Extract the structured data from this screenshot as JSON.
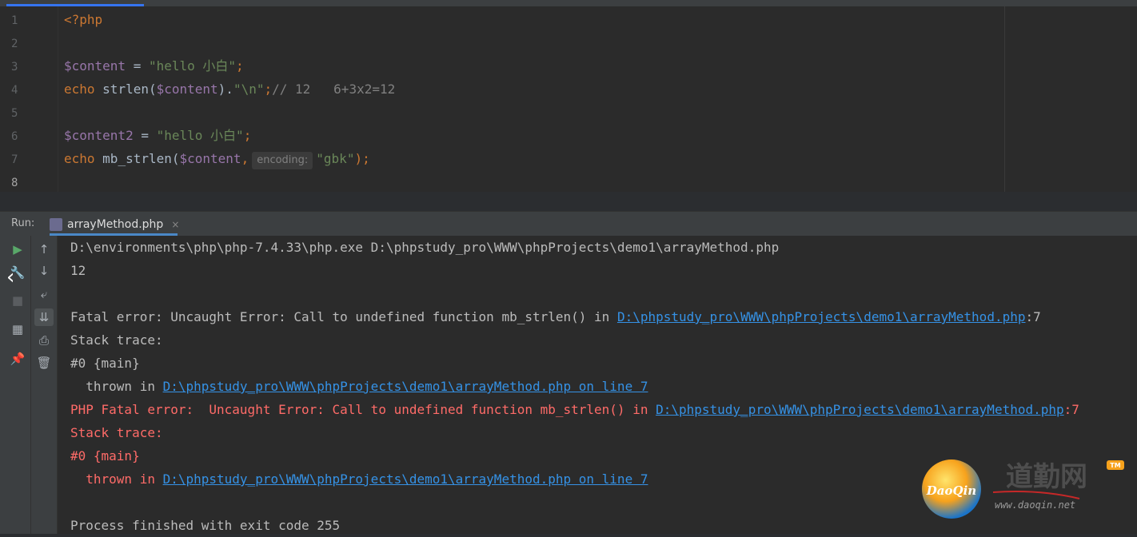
{
  "editor": {
    "line_numbers": [
      "1",
      "2",
      "3",
      "4",
      "5",
      "6",
      "7",
      "8"
    ],
    "lines": [
      [
        {
          "t": "<?php",
          "c": "kw"
        }
      ],
      [],
      [
        {
          "t": "$content",
          "c": "var"
        },
        {
          "t": " = ",
          "c": "plain"
        },
        {
          "t": "\"hello 小白\"",
          "c": "str"
        },
        {
          "t": ";",
          "c": "kw"
        }
      ],
      [
        {
          "t": "echo ",
          "c": "kw"
        },
        {
          "t": "strlen(",
          "c": "plain"
        },
        {
          "t": "$content",
          "c": "var"
        },
        {
          "t": ").",
          "c": "plain"
        },
        {
          "t": "\"\\n\"",
          "c": "str"
        },
        {
          "t": ";",
          "c": "kw"
        },
        {
          "t": "// 12   6+3x2=12",
          "c": "cmt"
        }
      ],
      [],
      [
        {
          "t": "$content2",
          "c": "var"
        },
        {
          "t": " = ",
          "c": "plain"
        },
        {
          "t": "\"hello 小白\"",
          "c": "str"
        },
        {
          "t": ";",
          "c": "kw"
        }
      ],
      [
        {
          "t": "echo ",
          "c": "kw"
        },
        {
          "t": "mb_strlen(",
          "c": "plain"
        },
        {
          "t": "$content",
          "c": "var"
        },
        {
          "t": ",",
          "c": "kw"
        },
        {
          "t": "encoding:",
          "c": "hint"
        },
        {
          "t": "\"gbk\"",
          "c": "str"
        },
        {
          "t": ");",
          "c": "kw"
        }
      ],
      []
    ]
  },
  "run_panel": {
    "label": "Run:",
    "tab_label": "arrayMethod.php",
    "tab_close": "×"
  },
  "console": {
    "lines": [
      [
        {
          "t": "D:\\environments\\php\\php-7.4.33\\php.exe D:\\phpstudy_pro\\WWW\\phpProjects\\demo1\\arrayMethod.php",
          "c": "norm"
        }
      ],
      [
        {
          "t": "12",
          "c": "norm"
        }
      ],
      [],
      [
        {
          "t": "Fatal error: Uncaught Error: Call to undefined function mb_strlen() in ",
          "c": "norm"
        },
        {
          "t": "D:\\phpstudy_pro\\WWW\\phpProjects\\demo1\\arrayMethod.php",
          "c": "link"
        },
        {
          "t": ":7",
          "c": "norm"
        }
      ],
      [
        {
          "t": "Stack trace:",
          "c": "norm"
        }
      ],
      [
        {
          "t": "#0 {main}",
          "c": "norm"
        }
      ],
      [
        {
          "t": "  thrown in ",
          "c": "norm"
        },
        {
          "t": "D:\\phpstudy_pro\\WWW\\phpProjects\\demo1\\arrayMethod.php on line 7",
          "c": "link"
        }
      ],
      [
        {
          "t": "PHP Fatal error:  Uncaught Error: Call to undefined function mb_strlen() in ",
          "c": "err"
        },
        {
          "t": "D:\\phpstudy_pro\\WWW\\phpProjects\\demo1\\arrayMethod.php",
          "c": "link"
        },
        {
          "t": ":7",
          "c": "err"
        }
      ],
      [
        {
          "t": "Stack trace:",
          "c": "err"
        }
      ],
      [
        {
          "t": "#0 {main}",
          "c": "err"
        }
      ],
      [
        {
          "t": "  thrown in ",
          "c": "err"
        },
        {
          "t": "D:\\phpstudy_pro\\WWW\\phpProjects\\demo1\\arrayMethod.php on line 7",
          "c": "link"
        }
      ],
      [],
      [
        {
          "t": "Process finished with exit code 255",
          "c": "norm"
        }
      ]
    ]
  },
  "watermark": {
    "badge_text": "DaoQin",
    "brand_cn": "道勤网",
    "url": "www.daoqin.net",
    "tm": "TM"
  },
  "colors": {
    "keyword": "#cc7832",
    "variable": "#9876aa",
    "string": "#6a8759",
    "error": "#ff6b68",
    "link": "#3592e6"
  }
}
